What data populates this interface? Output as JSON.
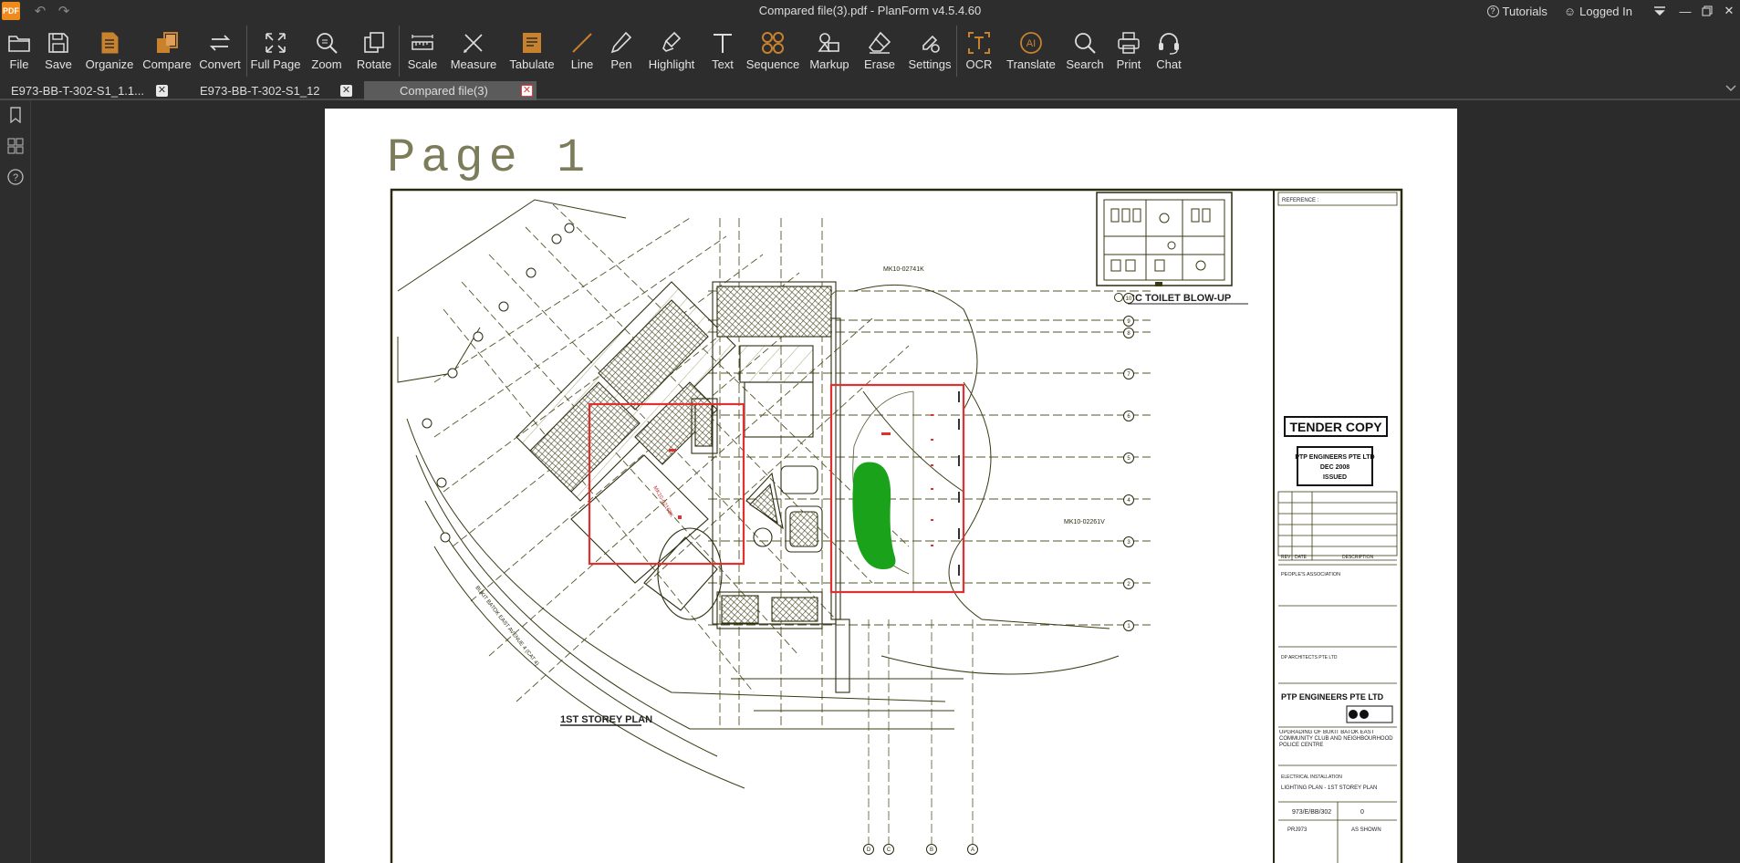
{
  "app": {
    "logo_text": "PDF",
    "window_title": "Compared file(3).pdf - PlanForm v4.5.4.60",
    "tutorials_label": "Tutorials",
    "account_label": "Logged In"
  },
  "toolbar": {
    "file": "File",
    "save": "Save",
    "organize": "Organize",
    "compare": "Compare",
    "convert": "Convert",
    "full_page": "Full Page",
    "zoom": "Zoom",
    "rotate": "Rotate",
    "scale": "Scale",
    "measure": "Measure",
    "tabulate": "Tabulate",
    "line": "Line",
    "pen": "Pen",
    "highlight": "Highlight",
    "text": "Text",
    "sequence": "Sequence",
    "markup": "Markup",
    "erase": "Erase",
    "settings": "Settings",
    "ocr": "OCR",
    "translate": "Translate",
    "search": "Search",
    "print": "Print",
    "chat": "Chat",
    "accent_color": "#c8822e"
  },
  "tabs": [
    {
      "label": "E973-BB-T-302-S1_1.1..."
    },
    {
      "label": "E973-BB-T-302-S1_12"
    },
    {
      "label": "Compared file(3)",
      "active": true
    }
  ],
  "drawing": {
    "page_heading": "Page 1",
    "toilet_title": "CC TOILET BLOW-UP",
    "tender_stamp": "TENDER COPY",
    "engineer_stamp": [
      "PTP ENGINEERS PTE LTD",
      "DEC 2008",
      "ISSUED"
    ],
    "plan_title": "1ST STOREY PLAN",
    "firm_name": "PTP ENGINEERS PTE LTD",
    "reference_label": "REFERENCE :",
    "rev_headers": [
      "REV",
      "DATE",
      "DESCRIPTION"
    ],
    "developer": "PEOPLE'S ASSOCIATION",
    "architect": "DP ARCHITECTS PTE LTD",
    "project_title": "UPGRADING OF BUKIT BATOK EAST COMMUNITY CLUB AND NEIGHBOURHOOD POLICE CENTRE",
    "drawing_title_label": "ELECTRICAL INSTALLATION",
    "drawing_title": "LIGHTING PLAN - 1ST STOREY PLAN",
    "drawing_no": "973/E/BB/302",
    "rev_no": "0",
    "project_no": "PRJ973",
    "scale": "AS SHOWN",
    "grid_labels_right": [
      "10",
      "9",
      "8",
      "7",
      "6",
      "5",
      "4",
      "3",
      "2",
      "1"
    ],
    "grid_labels_bottom": [
      "D",
      "C",
      "B",
      "A"
    ],
    "markers": [
      "MK10-02741K",
      "MK10-02261V",
      "MK10-02168K"
    ],
    "road_label": "BUKIT BATOK EAST AVENUE 4 (CAT 4)"
  },
  "diff_colors": {
    "changed_box": "#e23030",
    "added_fill": "#1aa31a",
    "drawing_ink": "#3a3a12"
  }
}
